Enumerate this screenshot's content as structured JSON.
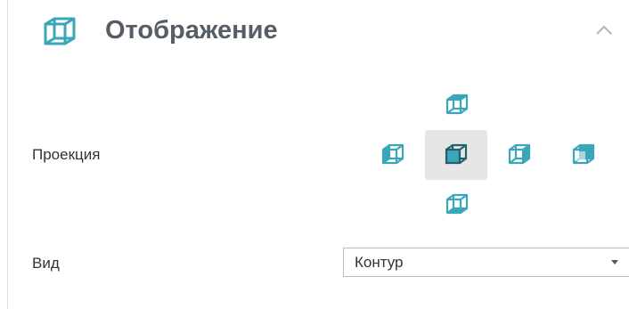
{
  "section": {
    "title": "Отображение",
    "icon": "cube-wireframe-icon",
    "collapse_icon": "chevron-up-icon"
  },
  "projection": {
    "label": "Проекция",
    "selected": "front",
    "buttons": [
      {
        "name": "top",
        "icon": "cube-top-view-icon"
      },
      {
        "name": "left",
        "icon": "cube-left-view-icon"
      },
      {
        "name": "front",
        "icon": "cube-front-view-icon"
      },
      {
        "name": "right",
        "icon": "cube-right-view-icon"
      },
      {
        "name": "back",
        "icon": "cube-back-view-icon"
      },
      {
        "name": "bottom",
        "icon": "cube-bottom-view-icon"
      }
    ]
  },
  "view": {
    "label": "Вид",
    "value": "Контур",
    "dropdown_icon": "caret-down-icon"
  },
  "colors": {
    "accent": "#3aa6b9",
    "title_text": "#555d66",
    "selected_bg": "#e6e6e6"
  }
}
